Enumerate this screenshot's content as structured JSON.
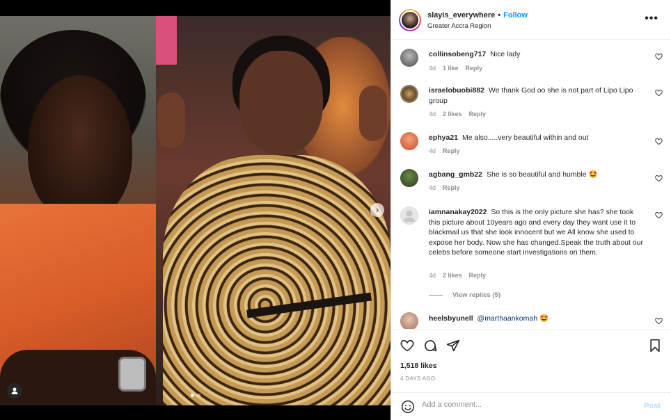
{
  "post": {
    "username": "slayis_everywhere",
    "follow_label": "Follow",
    "location": "Greater Accra Region",
    "more_label": "•••",
    "likes": "1,518 likes",
    "date": "4 DAYS AGO",
    "carousel": {
      "total": 2,
      "current": 1
    }
  },
  "comments": [
    {
      "user": "collinsobeng717",
      "text": "Nice lady",
      "time": "4d",
      "likes": "1 like",
      "reply": "Reply"
    },
    {
      "user": "israelobuobi882",
      "text": "We thank God oo she is not part of Lipo Lipo group",
      "time": "4d",
      "likes": "2 likes",
      "reply": "Reply"
    },
    {
      "user": "ephya21",
      "text": "Me also.....very beautiful within and out",
      "time": "4d",
      "likes": "",
      "reply": "Reply"
    },
    {
      "user": "agbang_gmb22",
      "text": "She is so beautiful and humble 🤩",
      "time": "4d",
      "likes": "",
      "reply": "Reply"
    },
    {
      "user": "iamnanakay2022",
      "text": "So this is the only picture she has? she took this picture about 10years ago and every day they want use it to blackmail us that she look innocent but we All know she used to expose her body. Now she has changed.Speak the truth about our celebs before someone start investigations on them.",
      "time": "4d",
      "likes": "2 likes",
      "reply": "Reply",
      "view_replies": "View replies (5)"
    },
    {
      "user": "heelsbyunell",
      "mention": "@marthaankomah",
      "text": " 🤩"
    }
  ],
  "add_comment": {
    "placeholder": "Add a comment...",
    "post_label": "Post"
  },
  "icons": {
    "like": "heart-icon",
    "comment": "comment-icon",
    "share": "share-icon",
    "save": "bookmark-icon",
    "emoji": "emoji-icon",
    "more": "more-icon",
    "tag": "user-tag-icon",
    "next": "chevron-right-icon"
  },
  "colors": {
    "link": "#0095f6",
    "muted": "#8e8e8e",
    "post_disabled": "#b2dffc"
  }
}
